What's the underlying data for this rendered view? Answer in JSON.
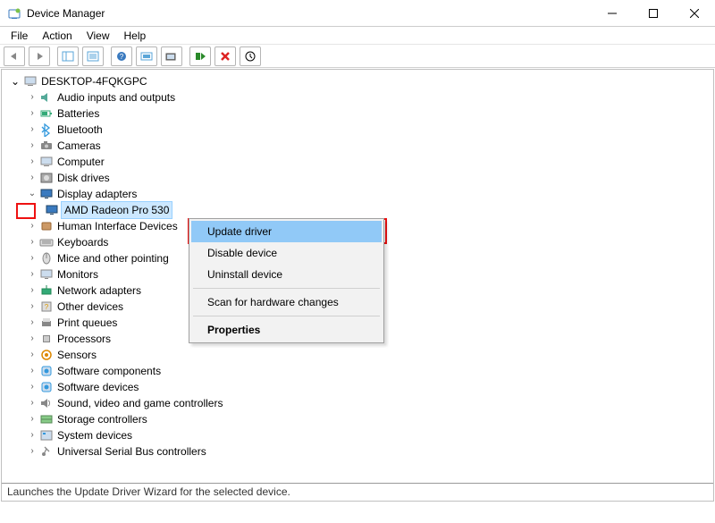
{
  "window": {
    "title": "Device Manager",
    "min_tip": "—",
    "max_tip": "☐",
    "close_tip": "✕"
  },
  "menubar": [
    "File",
    "Action",
    "View",
    "Help"
  ],
  "toolbar": [
    "back",
    "forward",
    "options",
    "properties",
    "help",
    "scan",
    "monitor",
    "install",
    "remove",
    "update"
  ],
  "tree": {
    "root": "DESKTOP-4FQKGPC",
    "nodes": [
      {
        "label": "Audio inputs and outputs",
        "icon": "speaker"
      },
      {
        "label": "Batteries",
        "icon": "battery"
      },
      {
        "label": "Bluetooth",
        "icon": "bluetooth"
      },
      {
        "label": "Cameras",
        "icon": "camera"
      },
      {
        "label": "Computer",
        "icon": "computer"
      },
      {
        "label": "Disk drives",
        "icon": "disk"
      },
      {
        "label": "Display adapters",
        "icon": "display",
        "expanded": true,
        "selected": false,
        "children": [
          {
            "label": "AMD Radeon Pro 530",
            "icon": "display",
            "selected": true
          }
        ]
      },
      {
        "label": "Human Interface Devices",
        "icon": "hid"
      },
      {
        "label": "Keyboards",
        "icon": "keyboard"
      },
      {
        "label": "Mice and other pointing",
        "icon": "mouse"
      },
      {
        "label": "Monitors",
        "icon": "monitor"
      },
      {
        "label": "Network adapters",
        "icon": "network"
      },
      {
        "label": "Other devices",
        "icon": "other"
      },
      {
        "label": "Print queues",
        "icon": "printer"
      },
      {
        "label": "Processors",
        "icon": "cpu"
      },
      {
        "label": "Sensors",
        "icon": "sensor"
      },
      {
        "label": "Software components",
        "icon": "sw"
      },
      {
        "label": "Software devices",
        "icon": "sw"
      },
      {
        "label": "Sound, video and game controllers",
        "icon": "sound"
      },
      {
        "label": "Storage controllers",
        "icon": "storage"
      },
      {
        "label": "System devices",
        "icon": "system"
      },
      {
        "label": "Universal Serial Bus controllers",
        "icon": "usb"
      }
    ]
  },
  "context_menu": {
    "items": [
      {
        "label": "Update driver",
        "highlight": true
      },
      {
        "label": "Disable device"
      },
      {
        "label": "Uninstall device"
      },
      {
        "sep": true
      },
      {
        "label": "Scan for hardware changes"
      },
      {
        "sep": true
      },
      {
        "label": "Properties",
        "bold": true
      }
    ]
  },
  "statusbar": "Launches the Update Driver Wizard for the selected device."
}
